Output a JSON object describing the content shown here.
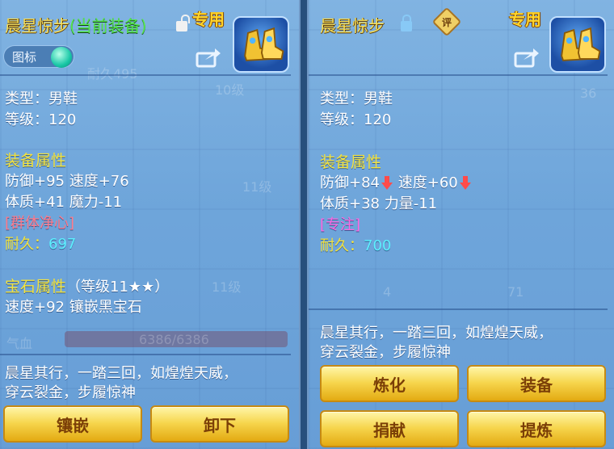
{
  "left_panel": {
    "item_name": "晨星惊步",
    "equipped_tag": "(当前装备)",
    "exclusive_label": "专用",
    "icon_toggle_label": "图标",
    "type_line": "类型：男鞋",
    "level_line": "等级：120",
    "equip_attrs_title": "装备属性",
    "attr_line1": "防御+95 速度+76",
    "attr_line2": "体质+41 魔力-11",
    "special_skill": "[群体净心]",
    "durability_label": "耐久：",
    "durability_value": "697",
    "gem_title": "宝石属性",
    "gem_level": "（等级11★★）",
    "gem_line": "速度+92 镶嵌黑宝石",
    "desc_line1": "晨星其行，一踏三回，如煌煌天威，",
    "desc_line2": "穿云裂金，步履惊神",
    "buttons": [
      "镶嵌",
      "卸下"
    ],
    "bg_texts": [
      "耐久495",
      "10级",
      "11级",
      "11级",
      "气血",
      "6386/6386"
    ]
  },
  "right_panel": {
    "item_name": "晨星惊步",
    "rate_badge": "评",
    "exclusive_label": "专用",
    "type_line": "类型：男鞋",
    "level_line": "等级：120",
    "equip_attrs_title": "装备属性",
    "defense": "防御+84",
    "speed": "速度+60",
    "attr_line2": "体质+38 力量-11",
    "special_skill": "[专注]",
    "durability_label": "耐久：",
    "durability_value": "700",
    "desc_line1": "晨星其行，一踏三回，如煌煌天威，",
    "desc_line2": "穿云裂金，步履惊神",
    "buttons": [
      "炼化",
      "装备",
      "捐献",
      "提炼"
    ],
    "bg_texts": [
      "36",
      "4",
      "71"
    ]
  },
  "colors": {
    "title": "#f6e05a",
    "equipped": "#55e64e",
    "section": "#f4e33d",
    "skill_left": "#ff7a8a",
    "skill_right": "#ff66e0",
    "durability": "#5df0ff",
    "button": "#f6d54c",
    "down_arrow": "#ff4b4b"
  },
  "icons": [
    "lock-open-icon",
    "lock-closed-icon",
    "share-icon",
    "boots-item-icon",
    "rate-badge-icon",
    "down-arrow-icon",
    "toggle-knob-icon"
  ]
}
